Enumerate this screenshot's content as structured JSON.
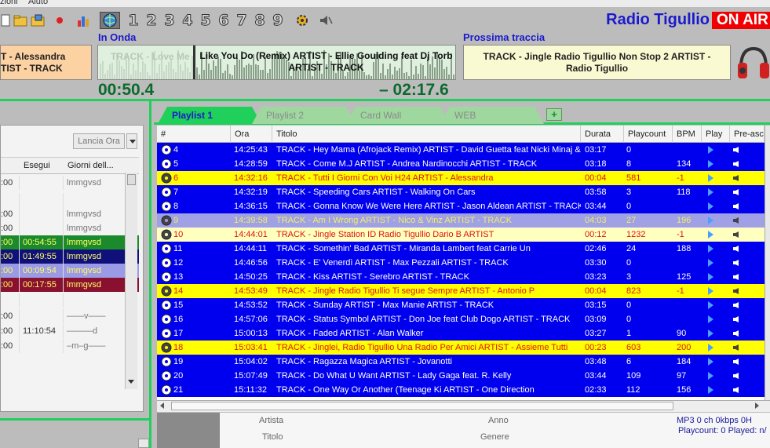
{
  "menu": {
    "items": [
      "zioni",
      "Aiuto"
    ]
  },
  "toolbar": {
    "numbers": [
      "1",
      "2",
      "3",
      "4",
      "5",
      "6",
      "7",
      "8",
      "9"
    ]
  },
  "header": {
    "station": "Radio Tigullio",
    "on_air": "ON AIR"
  },
  "prev": {
    "text": "T - Alessandra\nTIST - TRACK"
  },
  "now": {
    "label": "In Onda",
    "ghost": "TRACK - Love Me",
    "text": "Like You Do (Remix) ARTIST - Ellie Goulding feat Dj Torb  ARTIST - TRACK",
    "elapsed": "00:50.4",
    "remaining": "– 02:17.6"
  },
  "next": {
    "label": "Prossima traccia",
    "text": "TRACK - Jingle Radio Tigullio Non Stop 2  ARTIST - Radio Tigullio"
  },
  "left": {
    "launch_button": "Lancia Ora",
    "col_esegui": "Esegui",
    "col_giorni": "Giorni dell...",
    "rows": [
      {
        "t": ":00",
        "e": "",
        "g": "lmmgvsd",
        "style": "plain"
      },
      {
        "t": "",
        "e": "",
        "g": "",
        "style": "plain"
      },
      {
        "t": ":00",
        "e": "",
        "g": "lmmgvsd",
        "style": "plain"
      },
      {
        "t": ":00",
        "e": "",
        "g": "lmmgvsd",
        "style": "plain"
      },
      {
        "t": ":00",
        "e": "00:54:55",
        "g": "lmmgvsd",
        "style": "green"
      },
      {
        "t": ":00",
        "e": "01:49:55",
        "g": "lmmgvsd",
        "style": "navy"
      },
      {
        "t": ":00",
        "e": "00:09:54",
        "g": "lmmgvsd",
        "style": "lav"
      },
      {
        "t": ":00",
        "e": "00:17:55",
        "g": "lmmgvsd",
        "style": "maroon"
      },
      {
        "t": "",
        "e": "",
        "g": "",
        "style": "plain"
      },
      {
        "t": ":00",
        "e": "",
        "g": "——v——",
        "style": "plain"
      },
      {
        "t": ":00",
        "e": "11:10:54",
        "g": "———d",
        "style": "plain"
      },
      {
        "t": ":00",
        "e": "",
        "g": "–m–g——",
        "style": "plain"
      }
    ]
  },
  "tabs": [
    {
      "label": "Playlist 1",
      "active": true
    },
    {
      "label": "Playlist 2",
      "active": false
    },
    {
      "label": "Card Wall",
      "active": false
    },
    {
      "label": "WEB",
      "active": false
    }
  ],
  "columns": [
    "#",
    "Ora",
    "Titolo",
    "Durata",
    "Playcount",
    "BPM",
    "Play",
    "Pre-asc"
  ],
  "rows": [
    {
      "n": "4",
      "ora": "14:25:43",
      "titolo": "TRACK - Hey Mama (Afrojack Remix) ARTIST - David Guetta feat Nicki Minaj & ...",
      "dur": "03:17",
      "pc": "0",
      "bpm": "",
      "style": "blue"
    },
    {
      "n": "5",
      "ora": "14:28:59",
      "titolo": "TRACK - Come M.J ARTIST - Andrea Nardinocchi  ARTIST - TRACK",
      "dur": "03:18",
      "pc": "8",
      "bpm": "134",
      "style": "blue"
    },
    {
      "n": "6",
      "ora": "14:32:16",
      "titolo": "TRACK - Tutti I Giorni Con Voi H24  ARTIST - Alessandra",
      "dur": "00:04",
      "pc": "581",
      "bpm": "-1",
      "style": "yellow"
    },
    {
      "n": "7",
      "ora": "14:32:19",
      "titolo": "TRACK - Speeding Cars  ARTIST - Walking On Cars",
      "dur": "03:58",
      "pc": "3",
      "bpm": "118",
      "style": "blue"
    },
    {
      "n": "8",
      "ora": "14:36:15",
      "titolo": "TRACK - Gonna Know We Were Here ARTIST - Jason Aldean  ARTIST - TRACK",
      "dur": "03:44",
      "pc": "0",
      "bpm": "",
      "style": "blue"
    },
    {
      "n": "9",
      "ora": "14:39:58",
      "titolo": "TRACK - Am I Wrong ARTIST - Nico & Vinz  ARTIST - TRACK",
      "dur": "04:03",
      "pc": "27",
      "bpm": "196",
      "style": "played"
    },
    {
      "n": "10",
      "ora": "14:44:01",
      "titolo": "TRACK - Jingle Station ID  Radio Tigullio Dario B  ARTIST",
      "dur": "00:12",
      "pc": "1232",
      "bpm": "-1",
      "style": "pale"
    },
    {
      "n": "11",
      "ora": "14:44:11",
      "titolo": "TRACK - Somethin' Bad  ARTIST - Miranda Lambert feat Carrie Un",
      "dur": "02:46",
      "pc": "24",
      "bpm": "188",
      "style": "blue"
    },
    {
      "n": "12",
      "ora": "14:46:56",
      "titolo": "TRACK - E' Venerdì ARTIST - Max Pezzali  ARTIST - TRACK",
      "dur": "03:30",
      "pc": "0",
      "bpm": "",
      "style": "blue"
    },
    {
      "n": "13",
      "ora": "14:50:25",
      "titolo": "TRACK - Kiss ARTIST - Serebro  ARTIST - TRACK",
      "dur": "03:23",
      "pc": "3",
      "bpm": "125",
      "style": "blue"
    },
    {
      "n": "14",
      "ora": "14:53:49",
      "titolo": "TRACK - Jingle Radio Tigullio Ti segue Sempre  ARTIST - Antonio P",
      "dur": "00:04",
      "pc": "823",
      "bpm": "-1",
      "style": "yellow"
    },
    {
      "n": "15",
      "ora": "14:53:52",
      "titolo": "TRACK - Sunday ARTIST - Max Manie  ARTIST - TRACK",
      "dur": "03:15",
      "pc": "0",
      "bpm": "",
      "style": "blue"
    },
    {
      "n": "16",
      "ora": "14:57:06",
      "titolo": "TRACK - Status Symbol ARTIST - Don Joe feat Club Dogo  ARTIST - TRACK",
      "dur": "03:09",
      "pc": "0",
      "bpm": "",
      "style": "blue"
    },
    {
      "n": "17",
      "ora": "15:00:13",
      "titolo": "TRACK - Faded  ARTIST - Alan Walker",
      "dur": "03:27",
      "pc": "1",
      "bpm": "90",
      "style": "blue"
    },
    {
      "n": "18",
      "ora": "15:03:41",
      "titolo": "TRACK - Jinglei, Radio Tigullio Una Radio Per Amici  ARTIST - Assieme Tutti",
      "dur": "00:23",
      "pc": "603",
      "bpm": "200",
      "style": "yellow"
    },
    {
      "n": "19",
      "ora": "15:04:02",
      "titolo": "TRACK - Ragazza Magica  ARTIST - Jovanotti",
      "dur": "03:48",
      "pc": "6",
      "bpm": "184",
      "style": "blue"
    },
    {
      "n": "20",
      "ora": "15:07:49",
      "titolo": "TRACK - Do What U Want  ARTIST - Lady Gaga feat. R. Kelly",
      "dur": "03:44",
      "pc": "109",
      "bpm": "97",
      "style": "blue"
    },
    {
      "n": "21",
      "ora": "15:11:32",
      "titolo": "TRACK - One Way Or Another (Teenage Ki  ARTIST - One Direction",
      "dur": "02:33",
      "pc": "112",
      "bpm": "156",
      "style": "blue"
    }
  ],
  "bottom": {
    "artista": "Artista",
    "titolo": "Titolo",
    "anno": "Anno",
    "genere": "Genere",
    "format": "MP3 0 ch 0kbps 0H",
    "playcount": "Playcount: 0  Played: n/"
  },
  "colors": {
    "blue": "#0000ee",
    "yellow": "#ffff00",
    "played": "#a0a0e6",
    "pale": "#ffffc0",
    "green_accent": "#1fd05a",
    "station": "#1a1acc",
    "onair": "#f00000"
  }
}
